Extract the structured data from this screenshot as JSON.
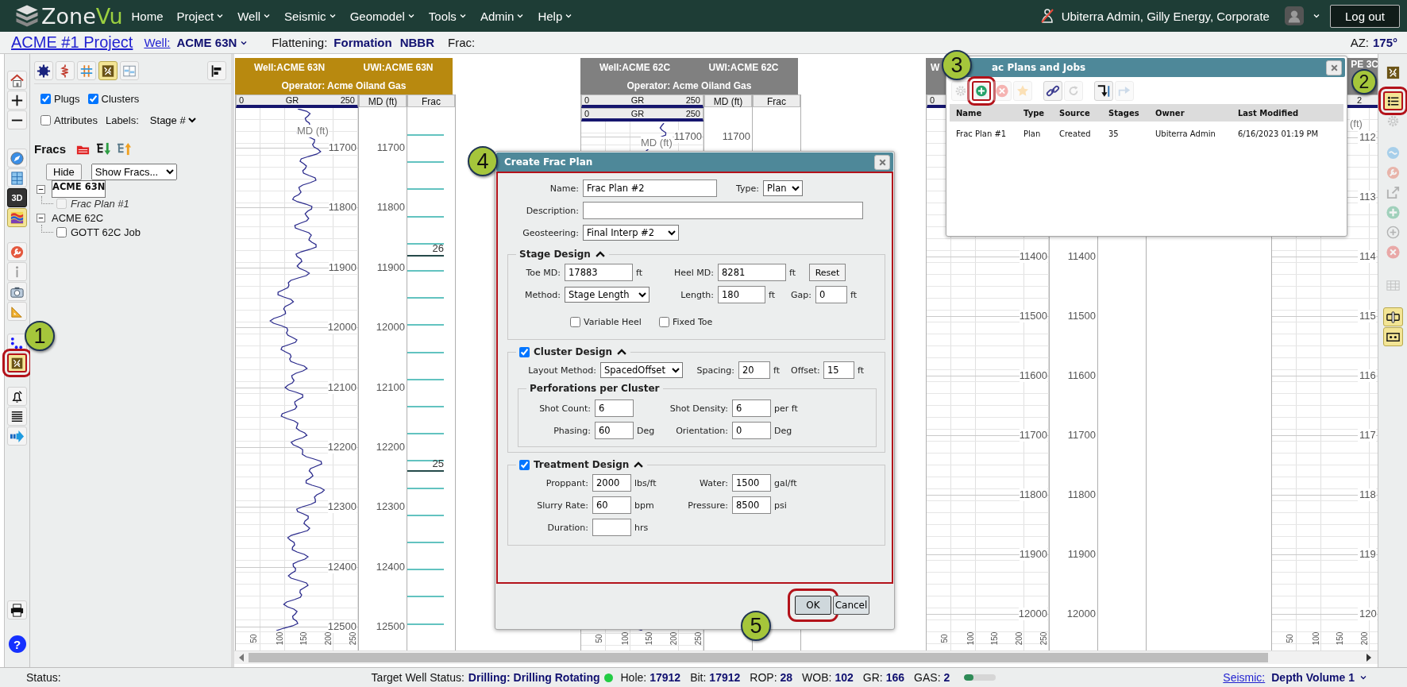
{
  "nav": {
    "brand": [
      "Zone",
      "Vu"
    ],
    "menu": [
      {
        "label": "Home",
        "dropdown": false
      },
      {
        "label": "Project",
        "dropdown": true
      },
      {
        "label": "Well",
        "dropdown": true
      },
      {
        "label": "Seismic",
        "dropdown": true
      },
      {
        "label": "Geomodel",
        "dropdown": true
      },
      {
        "label": "Tools",
        "dropdown": true
      },
      {
        "label": "Admin",
        "dropdown": true
      },
      {
        "label": "Help",
        "dropdown": true
      }
    ],
    "user": "Ubiterra Admin, Gilly Energy, Corporate",
    "logout": "Log out"
  },
  "header": {
    "project": "ACME #1 Project",
    "well_label": "Well:",
    "well": "ACME 63N",
    "flattening_label": "Flattening:",
    "flattening": [
      "Formation",
      "NBBR"
    ],
    "frac_label": "Frac:",
    "az_label": "AZ:",
    "az": "175°"
  },
  "left_toolbar": [
    {
      "kind": "house",
      "active": false,
      "highlighted": false
    },
    {
      "kind": "plus",
      "active": false,
      "highlighted": false
    },
    {
      "kind": "minus",
      "active": false,
      "highlighted": false
    },
    {
      "kind": "compass",
      "active": false,
      "highlighted": false
    },
    {
      "kind": "grid",
      "active": false,
      "highlighted": false
    },
    {
      "kind": "cube",
      "glyph": "3D",
      "active": false,
      "highlighted": false
    },
    {
      "kind": "layers",
      "active": true,
      "highlighted": false
    },
    {
      "kind": "wrench",
      "active": false,
      "highlighted": false
    },
    {
      "kind": "info",
      "active": false,
      "highlighted": false
    },
    {
      "kind": "camera",
      "active": false,
      "highlighted": false
    },
    {
      "kind": "ruler",
      "active": false,
      "highlighted": false
    },
    {
      "kind": "dots",
      "active": false,
      "highlighted": false
    },
    {
      "kind": "fracture",
      "active": true,
      "highlighted": true
    },
    {
      "kind": "bell",
      "active": false,
      "highlighted": false
    },
    {
      "kind": "lines",
      "active": false,
      "highlighted": false
    },
    {
      "kind": "arrow",
      "active": false,
      "highlighted": false
    },
    {
      "kind": "printer",
      "active": false,
      "highlighted": false
    },
    {
      "kind": "help",
      "glyph": "?",
      "active": false,
      "highlighted": false
    }
  ],
  "left_panel": {
    "tools": [
      {
        "kind": "starburst",
        "active": false
      },
      {
        "kind": "zigzag",
        "active": false
      },
      {
        "kind": "hash",
        "active": false
      },
      {
        "kind": "fracture",
        "active": true
      },
      {
        "kind": "panels",
        "active": false
      },
      {
        "kind": "align",
        "active": false
      }
    ],
    "options": [
      {
        "label": "Plugs",
        "checked": true
      },
      {
        "label": "Clusters",
        "checked": true
      },
      {
        "label": "Attributes",
        "checked": false
      }
    ],
    "labels_label": "Labels:",
    "labels_value": "Stage #",
    "fracs_title": "Fracs",
    "fracs_tools": [
      {
        "kind": "folder"
      },
      {
        "kind": "tree-down"
      },
      {
        "kind": "tree-up"
      }
    ],
    "hide": "Hide",
    "show": "Show Fracs...",
    "tree": [
      {
        "label": "ACME 63N",
        "selected": true,
        "expanded": true,
        "children": [
          {
            "label": "Frac Plan #1",
            "kind": "plan",
            "checked": false,
            "disabled": true
          }
        ]
      },
      {
        "label": "ACME 62C",
        "selected": false,
        "expanded": true,
        "children": [
          {
            "label": "GOTT 62C Job",
            "kind": "job",
            "checked": false,
            "disabled": false
          }
        ]
      }
    ]
  },
  "panels": [
    {
      "color": "#b8890f",
      "well": "Well:ACME 63N",
      "uwi": "UWI:ACME 63N",
      "operator": "Operator: Acme Oiland Gas",
      "scales": [
        {
          "min": "0",
          "name": "GR",
          "max": "250"
        }
      ],
      "md_header": "MD (ft)",
      "frac_header": "Frac",
      "curve": true,
      "curve_label": "MD (ft)",
      "gr_depths": [
        "11700",
        "11800",
        "11900",
        "12000",
        "12100",
        "12200",
        "12300",
        "12400",
        "12500"
      ],
      "md_depths": [
        "11700",
        "11800",
        "11900",
        "12000",
        "12100",
        "12200",
        "12300",
        "12400",
        "12500"
      ],
      "stage_marks": [
        {
          "label": "26"
        },
        {
          "label": "25"
        }
      ],
      "bottom_ticks": [
        "50",
        "100",
        "150",
        "200",
        "250"
      ]
    },
    {
      "color": "#808080",
      "well": "Well:ACME 62C",
      "uwi": "UWI:ACME 62C",
      "operator": "Operator: Acme Oiland Gas",
      "scales": [
        {
          "min": "0",
          "name": "GR",
          "max": "250"
        },
        {
          "min": "0",
          "name": "GR",
          "max": "250"
        }
      ],
      "md_header": "MD (ft)",
      "frac_header": "Frac",
      "curve": true,
      "curve_label": "MD (ft)",
      "gr_depths": [
        "11700"
      ],
      "md_depths": [
        "11700"
      ],
      "bottom_ticks": [
        "50",
        "100",
        "150",
        "200",
        "250"
      ]
    },
    {
      "color": "#808080",
      "well": "W",
      "scales": [
        {
          "min": "0"
        }
      ],
      "gr_depths": [
        "11400",
        "11500",
        "11600",
        "11700",
        "11800",
        "11900",
        "12000"
      ],
      "md_depths": [
        "11400",
        "11500",
        "11600",
        "11700",
        "11800",
        "11900",
        "12000"
      ],
      "bottom_ticks": [
        "50",
        "100",
        "150",
        "200",
        "250"
      ]
    },
    {
      "color": "#808080",
      "well": "PE 3C",
      "scales": [
        {
          "max": "2"
        }
      ],
      "curve_label": "(ft)",
      "gr_depths": [
        "112",
        "113",
        "114",
        "115",
        "116",
        "117",
        "118",
        "119",
        "120"
      ],
      "bottom_ticks": [
        "50",
        "100",
        "150",
        "200"
      ]
    }
  ],
  "right_toolbar": [
    {
      "kind": "fracture",
      "active": false,
      "disabled": false,
      "highlighted": false
    },
    {
      "kind": "list",
      "active": true,
      "disabled": false,
      "highlighted": true
    },
    {
      "kind": "gear",
      "active": false,
      "disabled": true,
      "highlighted": false
    },
    {
      "kind": "wave",
      "active": false,
      "disabled": true,
      "highlighted": false
    },
    {
      "kind": "wrench",
      "active": false,
      "disabled": true,
      "highlighted": false
    },
    {
      "kind": "external-link",
      "active": false,
      "disabled": true,
      "highlighted": false
    },
    {
      "kind": "add",
      "active": false,
      "disabled": true,
      "highlighted": false
    },
    {
      "kind": "add-outline",
      "active": false,
      "disabled": true,
      "highlighted": false
    },
    {
      "kind": "x-circle",
      "active": false,
      "disabled": true,
      "highlighted": false
    },
    {
      "kind": "table",
      "active": false,
      "disabled": true,
      "highlighted": false
    },
    {
      "kind": "splitter",
      "active": true,
      "disabled": false,
      "highlighted": false
    },
    {
      "kind": "dots-box",
      "active": true,
      "disabled": false,
      "highlighted": false
    }
  ],
  "frac_window": {
    "title": "ac Plans and Jobs",
    "tools": [
      {
        "kind": "gear",
        "disabled": true,
        "highlighted": false
      },
      {
        "kind": "add",
        "disabled": false,
        "highlighted": true
      },
      {
        "kind": "x-circle",
        "disabled": true,
        "highlighted": false
      },
      {
        "kind": "star",
        "disabled": true,
        "highlighted": false
      },
      {
        "kind": "link",
        "disabled": false,
        "highlighted": false
      },
      {
        "kind": "refresh",
        "disabled": true,
        "highlighted": false
      },
      {
        "kind": "import",
        "disabled": false,
        "highlighted": false
      },
      {
        "kind": "share",
        "disabled": true,
        "highlighted": false
      }
    ],
    "columns": [
      "Name",
      "Type",
      "Source",
      "Stages",
      "Owner",
      "Last Modified"
    ],
    "rows": [
      [
        "Frac Plan #1",
        "Plan",
        "Created",
        "35",
        "Ubiterra Admin",
        "6/16/2023 01:19 PM"
      ]
    ]
  },
  "create_dialog": {
    "title": "Create Frac Plan",
    "highlighted": true,
    "top_rows": [
      [
        {
          "kind": "input",
          "label": "Name:",
          "value": "Frac Plan #2"
        },
        {
          "kind": "select",
          "label": "Type:",
          "value": "Plan"
        }
      ],
      [
        {
          "kind": "input",
          "label": "Description:"
        }
      ],
      [
        {
          "kind": "select",
          "label": "Geosteering:",
          "value": "Final Interp #2"
        }
      ]
    ],
    "sections": [
      {
        "kind": "plain",
        "title": "Stage Design",
        "expanded": true,
        "rows": [
          [
            {
              "kind": "input",
              "label": "Toe MD:",
              "value": "17883",
              "unit": "ft"
            },
            {
              "kind": "input",
              "label": "Heel MD:",
              "value": "8281",
              "unit": "ft"
            },
            {
              "kind": "button",
              "value": "Reset"
            }
          ],
          [
            {
              "kind": "select",
              "label": "Method:",
              "value": "Stage Length"
            },
            {
              "kind": "input",
              "label": "Length:",
              "value": "180",
              "unit": "ft"
            },
            {
              "kind": "input",
              "label": "Gap:",
              "value": "0",
              "unit": "ft"
            }
          ],
          [
            {
              "kind": "checkbox",
              "value": "Variable Heel",
              "checked": false
            },
            {
              "kind": "checkbox",
              "value": "Fixed Toe",
              "checked": false
            }
          ]
        ]
      },
      {
        "kind": "checkable",
        "title": "Cluster Design",
        "checked": true,
        "expanded": true,
        "rows": [
          [
            {
              "kind": "select",
              "label": "Layout Method:",
              "value": "SpacedOffset"
            },
            {
              "kind": "input",
              "label": "Spacing:",
              "value": "20",
              "unit": "ft"
            },
            {
              "kind": "input",
              "label": "Offset:",
              "value": "15",
              "unit": "ft"
            }
          ]
        ],
        "subsection": {
          "title": "Perforations per Cluster",
          "rows": [
            [
              {
                "kind": "input",
                "label": "Shot Count:",
                "value": "6"
              },
              {
                "kind": "input",
                "label": "Shot Density:",
                "value": "6",
                "unit": "per ft"
              }
            ],
            [
              {
                "kind": "input",
                "label": "Phasing:",
                "value": "60",
                "unit": "Deg"
              },
              {
                "kind": "input",
                "label": "Orientation:",
                "value": "0",
                "unit": "Deg"
              }
            ]
          ]
        }
      },
      {
        "kind": "checkable",
        "title": "Treatment Design",
        "checked": true,
        "expanded": true,
        "rows": [
          [
            {
              "kind": "input",
              "label": "Proppant:",
              "value": "2000",
              "unit": "lbs/ft"
            },
            {
              "kind": "input",
              "label": "Water:",
              "value": "1500",
              "unit": "gal/ft"
            }
          ],
          [
            {
              "kind": "input",
              "label": "Slurry Rate:",
              "value": "60",
              "unit": "bpm"
            },
            {
              "kind": "input",
              "label": "Pressure:",
              "value": "8500",
              "unit": "psi"
            }
          ],
          [
            {
              "kind": "input",
              "label": "Duration:",
              "unit": "hrs"
            }
          ]
        ]
      }
    ],
    "buttons": [
      {
        "label": "OK",
        "highlighted": true
      },
      {
        "label": "Cancel",
        "highlighted": false
      }
    ]
  },
  "callouts": [
    "1",
    "2",
    "3",
    "4",
    "5"
  ],
  "status": {
    "label": "Status:",
    "target_label": "Target Well Status:",
    "target": "Drilling: Drilling Rotating",
    "metrics": [
      {
        "label": "Hole:",
        "value": "17912"
      },
      {
        "label": "Bit:",
        "value": "17912"
      },
      {
        "label": "ROP:",
        "value": "28"
      },
      {
        "label": "WOB:",
        "value": "102"
      },
      {
        "label": "GR:",
        "value": "166"
      },
      {
        "label": "GAS:",
        "value": "2"
      }
    ],
    "gas": {
      "level": 0.3
    },
    "seismic_label": "Seismic:",
    "seismic": "Depth Volume 1"
  }
}
